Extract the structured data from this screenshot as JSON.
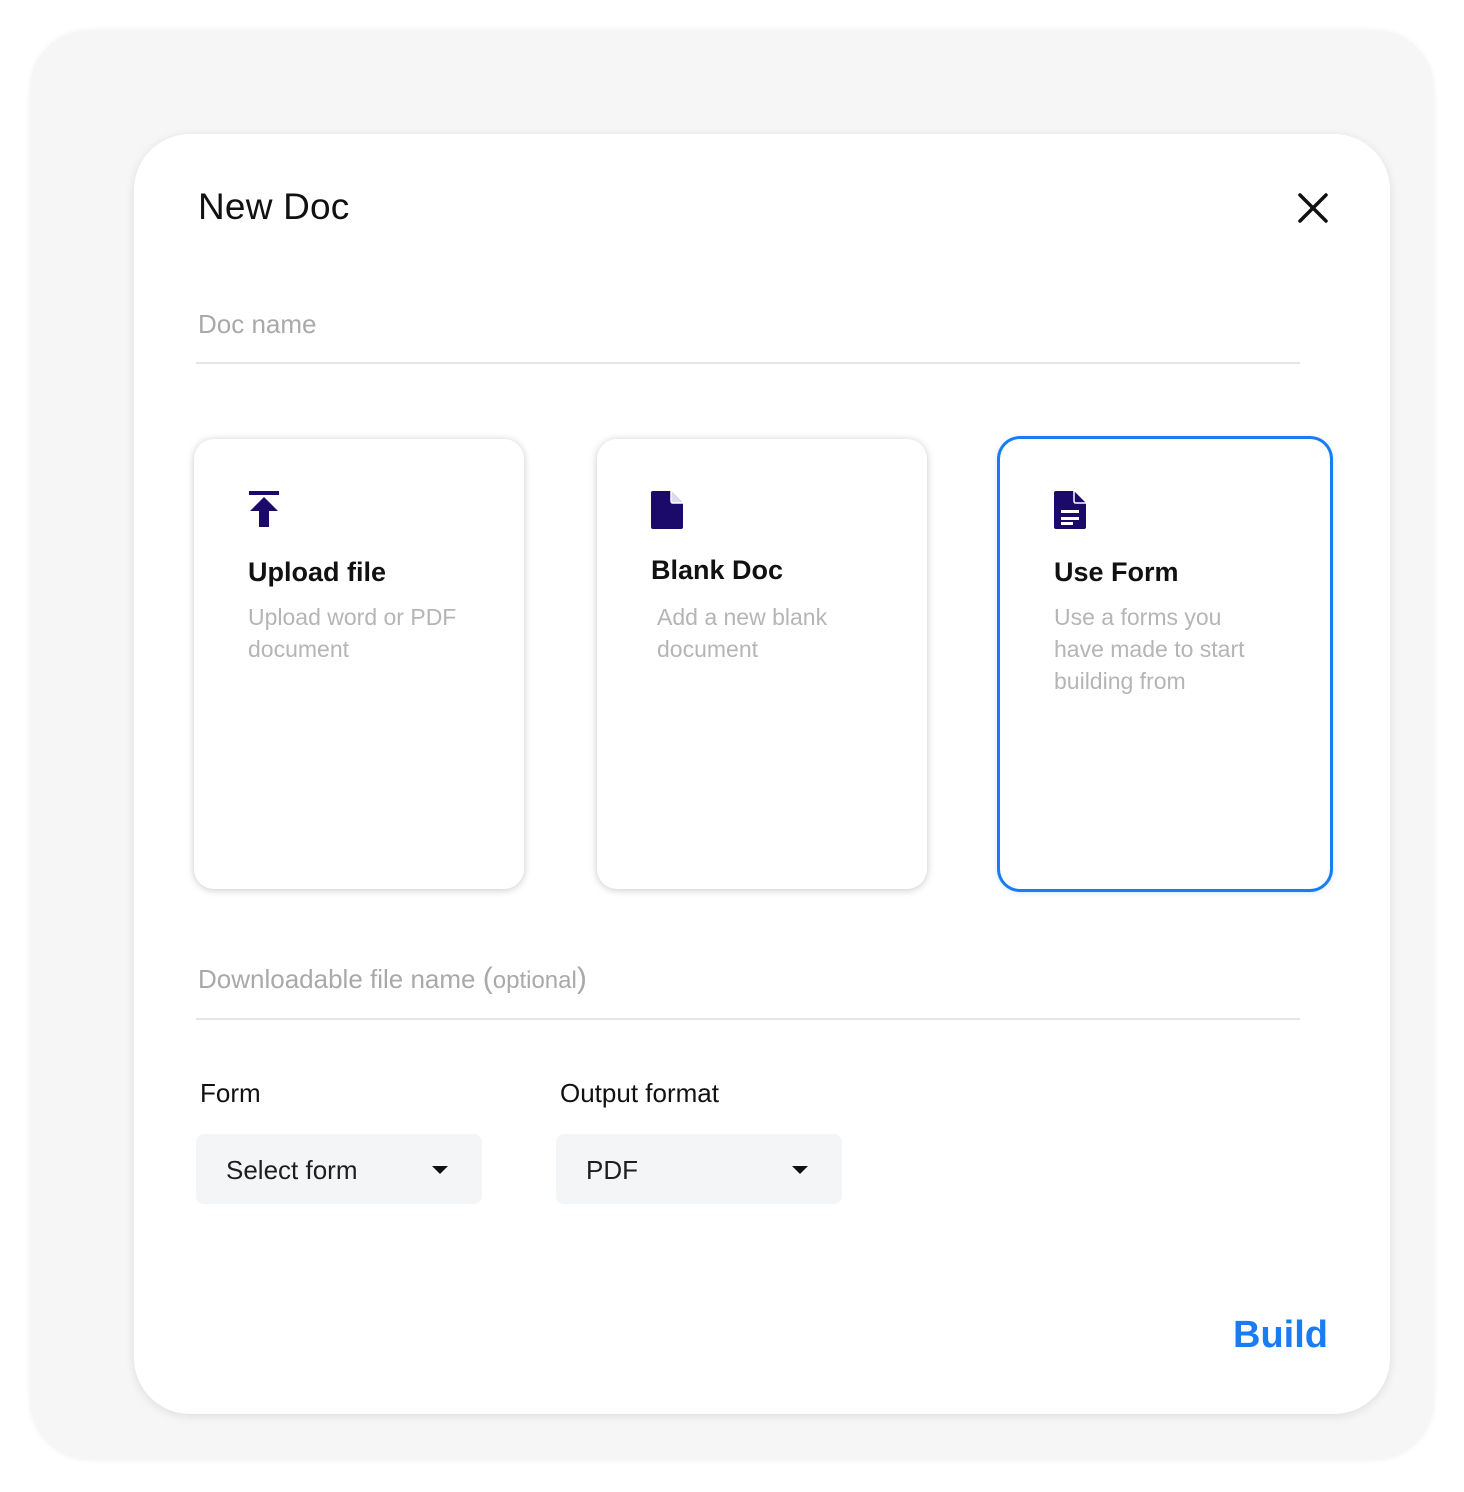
{
  "dialog": {
    "title": "New Doc",
    "close_icon": "close-icon"
  },
  "doc_name": {
    "placeholder": "Doc name",
    "value": ""
  },
  "options": [
    {
      "icon": "upload-icon",
      "title": "Upload file",
      "description": "Upload word or PDF document",
      "selected": false
    },
    {
      "icon": "blank-document-icon",
      "title": "Blank Doc",
      "description": "Add a new blank document",
      "selected": false
    },
    {
      "icon": "form-document-icon",
      "title": "Use Form",
      "description": "Use a forms you have made to start building from",
      "selected": true
    }
  ],
  "download_name": {
    "placeholder": "Downloadable file name",
    "optional_label": "optional",
    "value": ""
  },
  "form_select": {
    "label": "Form",
    "value": "Select form"
  },
  "output_select": {
    "label": "Output format",
    "value": "PDF"
  },
  "build_label": "Build",
  "colors": {
    "accent": "#1a7cf3",
    "icon": "#1c0a6b",
    "placeholder": "#a9a9a9"
  }
}
